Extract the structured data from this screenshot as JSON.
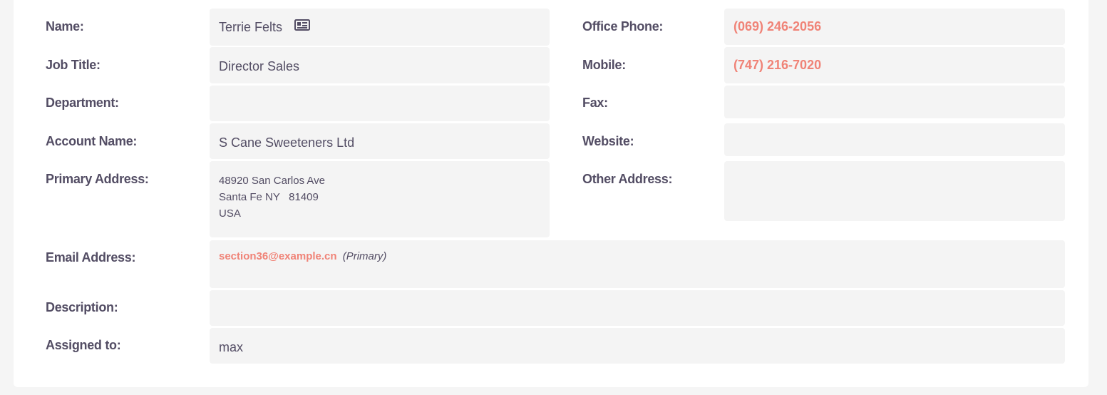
{
  "labels": {
    "name": "Name:",
    "job_title": "Job Title:",
    "department": "Department:",
    "account_name": "Account Name:",
    "primary_address": "Primary Address:",
    "office_phone": "Office Phone:",
    "mobile": "Mobile:",
    "fax": "Fax:",
    "website": "Website:",
    "other_address": "Other Address:",
    "email_address": "Email Address:",
    "description": "Description:",
    "assigned_to": "Assigned to:"
  },
  "contact": {
    "name": "Terrie Felts",
    "job_title": "Director Sales",
    "department": "",
    "account_name": "S Cane Sweeteners Ltd",
    "primary_address": {
      "street": "48920 San Carlos Ave",
      "city_state_zip": "Santa Fe NY   81409",
      "country": "USA"
    },
    "office_phone": "(069) 246-2056",
    "mobile": "(747) 216-7020",
    "fax": "",
    "website": "",
    "other_address": "",
    "email": "section36@example.cn",
    "email_tag": "(Primary)",
    "description": "",
    "assigned_to": "max"
  },
  "icons": {
    "vcard": "vcard-icon"
  },
  "colors": {
    "accent": "#f08377",
    "label": "#534d64",
    "field_bg": "#f4f4f4"
  }
}
